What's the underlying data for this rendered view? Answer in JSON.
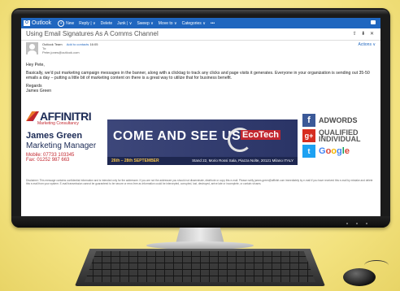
{
  "topbar": {
    "app_name": "Outlook",
    "new_label": "New",
    "commands": [
      "Reply | ∨",
      "Delete",
      "Junk | ∨",
      "Sweep ∨",
      "Move to ∨",
      "Categories ∨",
      "•••"
    ]
  },
  "message": {
    "subject": "Using Email Signatures As A Comms Channel",
    "subject_icons": "⇧ ⬇ ✕",
    "from_name": "Outlook Team",
    "add_contacts": "Add to contacts",
    "time": "16:05",
    "to_label": "To:",
    "address": "Peter.jones@outlook.com",
    "actions": "Actions ∨",
    "greeting": "Hey Pete,",
    "paragraph": "Basically, we'd put marketing campaign messages in the banner, along with a clicktag to track any clicks and page visits it generates. Everyone in your organization is sending out 35-50 emails a day – putting a little bit of marketing content on there is a great way to utilize that for business benefit.",
    "regards": "Regards",
    "sender": "James Green"
  },
  "signature": {
    "brand_name": "AFFINITRI",
    "brand_tagline": "Marketing Consultancy",
    "name": "James Green",
    "title": "Marketing Manager",
    "mobile": "Mobile: 07733 103345",
    "fax": "Fax: 01252 987 663",
    "banner_headline": "COME AND SEE US",
    "banner_brand": "EcoTech",
    "banner_brand_sub": "",
    "banner_date": "26th – 28th SEPTEMBER",
    "banner_location": "Stand 22, Morio Rossi Sala, Piazza Nolte, 20121 Milano ITALY",
    "social_badges": [
      "ADWORDS",
      "QUALIFIED",
      "INDIVIDUAL"
    ],
    "google_letters": [
      "G",
      "o",
      "o",
      "g",
      "l",
      "e"
    ]
  },
  "disclaimer": "Disclaimer: This message contains confidential information and is intended only for the addressee. If you are not the addressee you should not disseminate, distribute or copy this e-mail. Please notify james.green@affinitri.com immediately by e-mail if you have received this e-mail by mistake and delete this e-mail from your system. E-mail transmission cannot be guaranteed to be secure or error-free as information could be intercepted, corrupted, lost, destroyed, arrive late or incomplete, or contain viruses.",
  "colors": {
    "outlook_blue": "#1f66bf",
    "brand_navy": "#1b2a55",
    "brand_red": "#c2262e",
    "background": "#f6e88f"
  }
}
